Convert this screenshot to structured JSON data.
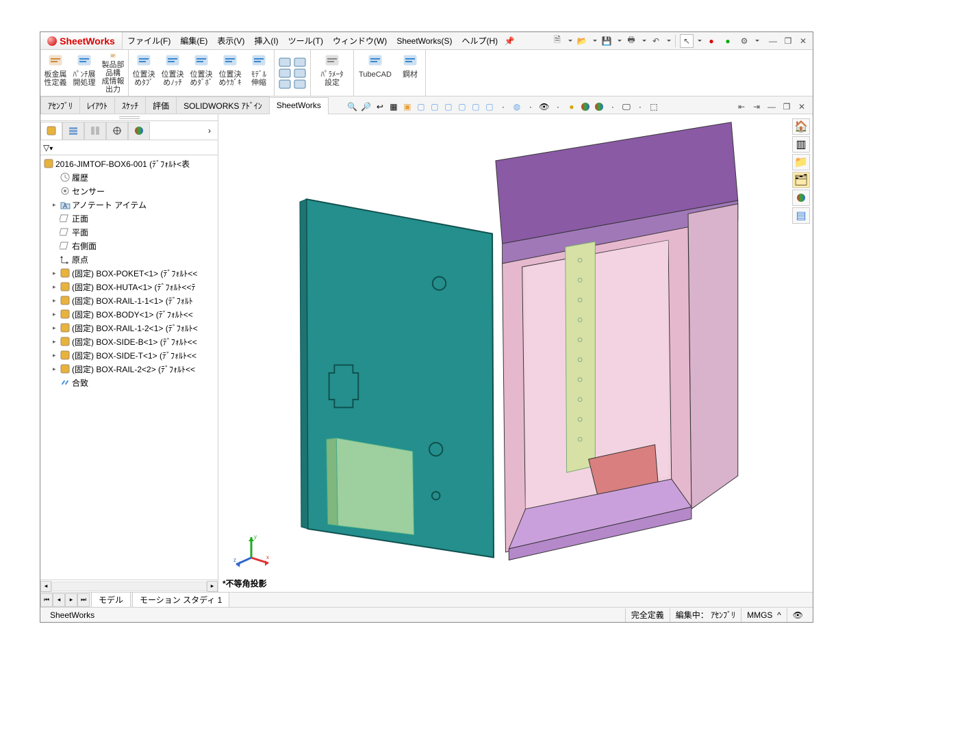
{
  "app_title": "SheetWorks",
  "menu": [
    "ファイル(F)",
    "編集(E)",
    "表示(V)",
    "挿入(I)",
    "ツール(T)",
    "ウィンドウ(W)",
    "SheetWorks(S)",
    "ヘルプ(H)"
  ],
  "ribbon_groups": [
    {
      "buttons": [
        {
          "label": "板金属\n性定義",
          "icon": "sheet"
        },
        {
          "label": "ﾊﾟﾝﾁ展\n開処理",
          "icon": "punch"
        },
        {
          "label": "製品部品構\n成情報出力",
          "icon": "parts"
        }
      ]
    },
    {
      "buttons": [
        {
          "label": "位置決\nめﾀﾌﾞ",
          "icon": "pos1"
        },
        {
          "label": "位置決\nめﾉｯﾁ",
          "icon": "pos2"
        },
        {
          "label": "位置決\nめﾀﾞﾎﾞ",
          "icon": "pos3"
        },
        {
          "label": "位置決\nめｹｶﾞｷ",
          "icon": "pos4"
        },
        {
          "label": "ﾓﾃﾞﾙ\n伸縮",
          "icon": "model"
        }
      ]
    },
    {
      "buttons": [
        {
          "label": "ﾊﾟﾗﾒｰﾀ\n設定",
          "icon": "param",
          "wide": true
        }
      ]
    },
    {
      "buttons": [
        {
          "label": "TubeCAD",
          "icon": "tube",
          "wide": true
        },
        {
          "label": "鋼材",
          "icon": "steel"
        }
      ]
    }
  ],
  "tabs": [
    "ｱｾﾝﾌﾞﾘ",
    "ﾚｲｱｳﾄ",
    "ｽｹｯﾁ",
    "評価",
    "SOLIDWORKS ｱﾄﾞｲﾝ",
    "SheetWorks"
  ],
  "active_tab": "SheetWorks",
  "tree_root": "2016-JIMTOF-BOX6-001 (ﾃﾞﾌｫﾙﾄ<表",
  "tree_items": [
    {
      "depth": 1,
      "icon": "hist",
      "text": "履歴"
    },
    {
      "depth": 1,
      "icon": "sensor",
      "text": "センサー"
    },
    {
      "depth": 1,
      "icon": "folder",
      "text": "アノテート アイテム",
      "expandable": true
    },
    {
      "depth": 1,
      "icon": "plane",
      "text": "正面"
    },
    {
      "depth": 1,
      "icon": "plane",
      "text": "平面"
    },
    {
      "depth": 1,
      "icon": "plane",
      "text": "右側面"
    },
    {
      "depth": 1,
      "icon": "origin",
      "text": "原点"
    },
    {
      "depth": 1,
      "icon": "part",
      "text": "(固定) BOX-POKET<1> (ﾃﾞﾌｫﾙﾄ<<",
      "expandable": true
    },
    {
      "depth": 1,
      "icon": "part",
      "text": "(固定) BOX-HUTA<1> (ﾃﾞﾌｫﾙﾄ<<ﾃ",
      "expandable": true
    },
    {
      "depth": 1,
      "icon": "part",
      "text": "(固定) BOX-RAIL-1-1<1> (ﾃﾞﾌｫﾙﾄ",
      "expandable": true
    },
    {
      "depth": 1,
      "icon": "part",
      "text": "(固定) BOX-BODY<1> (ﾃﾞﾌｫﾙﾄ<<",
      "expandable": true
    },
    {
      "depth": 1,
      "icon": "part",
      "text": "(固定) BOX-RAIL-1-2<1> (ﾃﾞﾌｫﾙﾄ<",
      "expandable": true
    },
    {
      "depth": 1,
      "icon": "part",
      "text": "(固定) BOX-SIDE-B<1> (ﾃﾞﾌｫﾙﾄ<<",
      "expandable": true
    },
    {
      "depth": 1,
      "icon": "part",
      "text": "(固定) BOX-SIDE-T<1> (ﾃﾞﾌｫﾙﾄ<<",
      "expandable": true
    },
    {
      "depth": 1,
      "icon": "part",
      "text": "(固定) BOX-RAIL-2<2> (ﾃﾞﾌｫﾙﾄ<<",
      "expandable": true
    },
    {
      "depth": 1,
      "icon": "mates",
      "text": "合致"
    }
  ],
  "bottom_tabs": [
    "モデル",
    "モーション スタディ 1"
  ],
  "viewport_label": "*不等角投影",
  "status": {
    "left": "SheetWorks",
    "def": "完全定義",
    "edit": "編集中： ｱｾﾝﾌﾞﾘ",
    "units": "MMGS",
    "marker": "^"
  }
}
